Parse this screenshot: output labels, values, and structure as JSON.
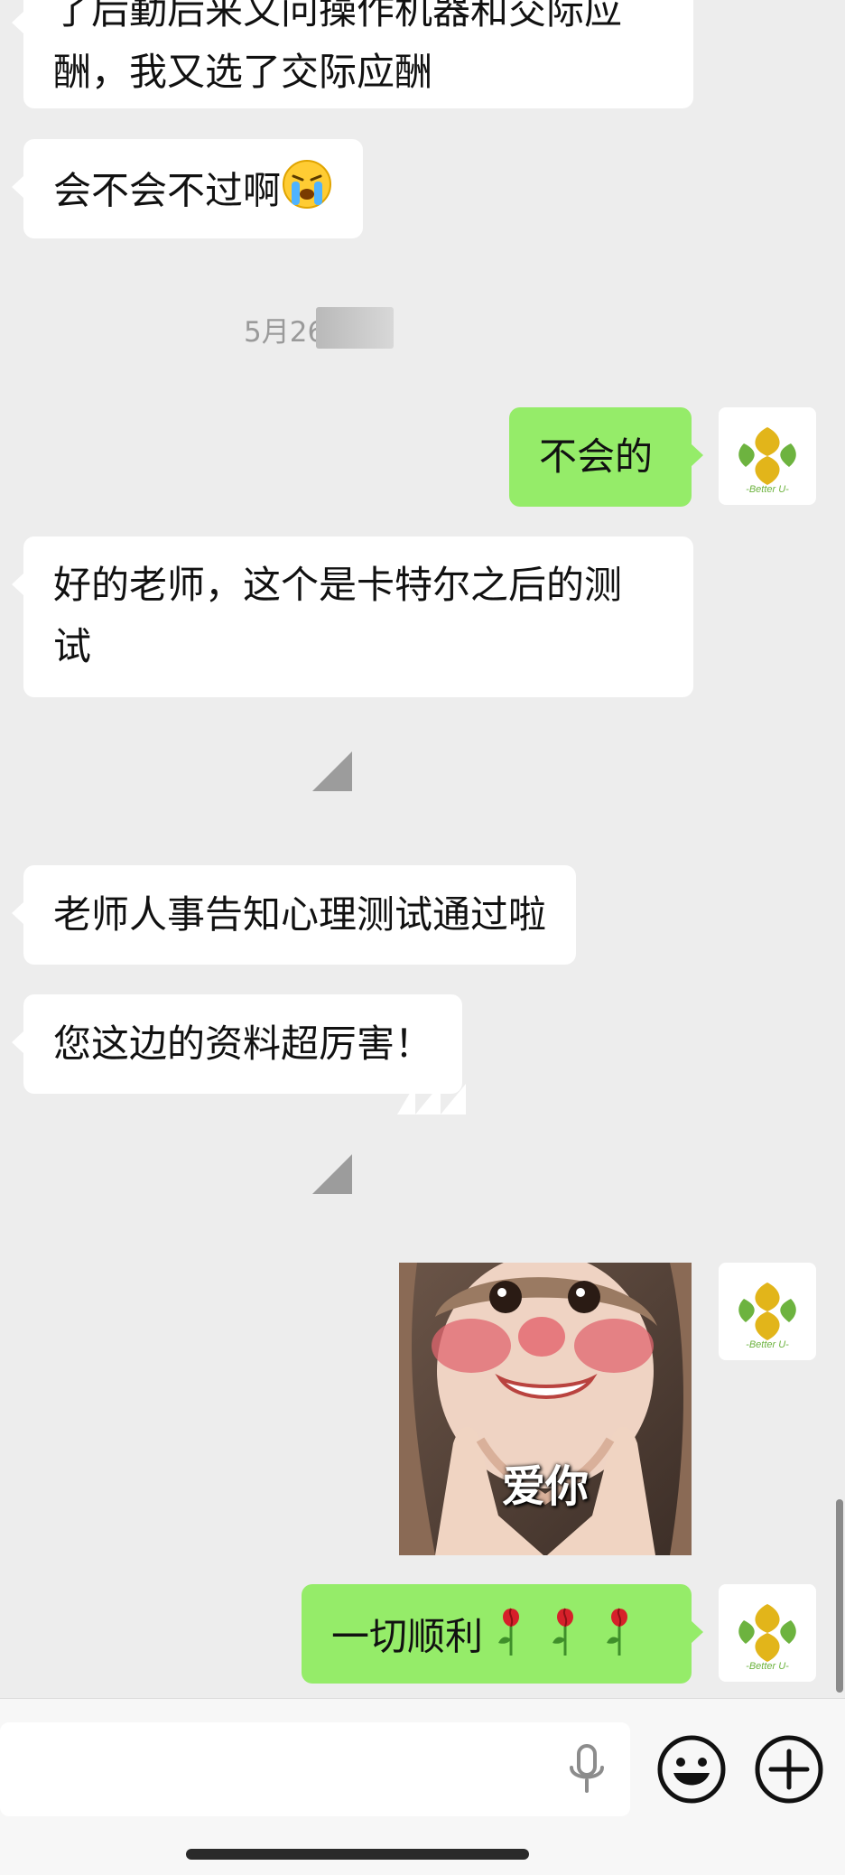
{
  "messages": [
    {
      "id": "m1",
      "side": "received",
      "lines": [
        "了后勤后来又问操作机器和交际应",
        "酬，我又选了交际应酬"
      ]
    },
    {
      "id": "m2",
      "side": "received",
      "text": "会不会不过啊",
      "emoji": "crying-face"
    },
    {
      "id": "m3",
      "side": "sent",
      "text": "不会的"
    },
    {
      "id": "m4",
      "side": "received",
      "lines": [
        "好的老师，这个是卡特尔之后的测",
        "试"
      ]
    },
    {
      "id": "m5",
      "side": "received",
      "text": "老师人事告知心理测试通过啦"
    },
    {
      "id": "m6",
      "side": "received",
      "text": "您这边的资料超厉害！"
    },
    {
      "id": "m7",
      "side": "sent",
      "type": "sticker",
      "caption": "爱你"
    },
    {
      "id": "m8",
      "side": "sent",
      "text": "一切顺利",
      "emoji": "rose-x3"
    }
  ],
  "timestamp": "5月26",
  "avatar": {
    "label": "-Better U-",
    "colors": {
      "gold": "#e2b51a",
      "green": "#6db33f"
    }
  },
  "colors": {
    "sent_bubble": "#95ec69",
    "received_bubble": "#ffffff",
    "background": "#ededed"
  },
  "input": {
    "placeholder": ""
  },
  "icons": [
    "microphone-icon",
    "emoji-icon",
    "plus-icon"
  ]
}
